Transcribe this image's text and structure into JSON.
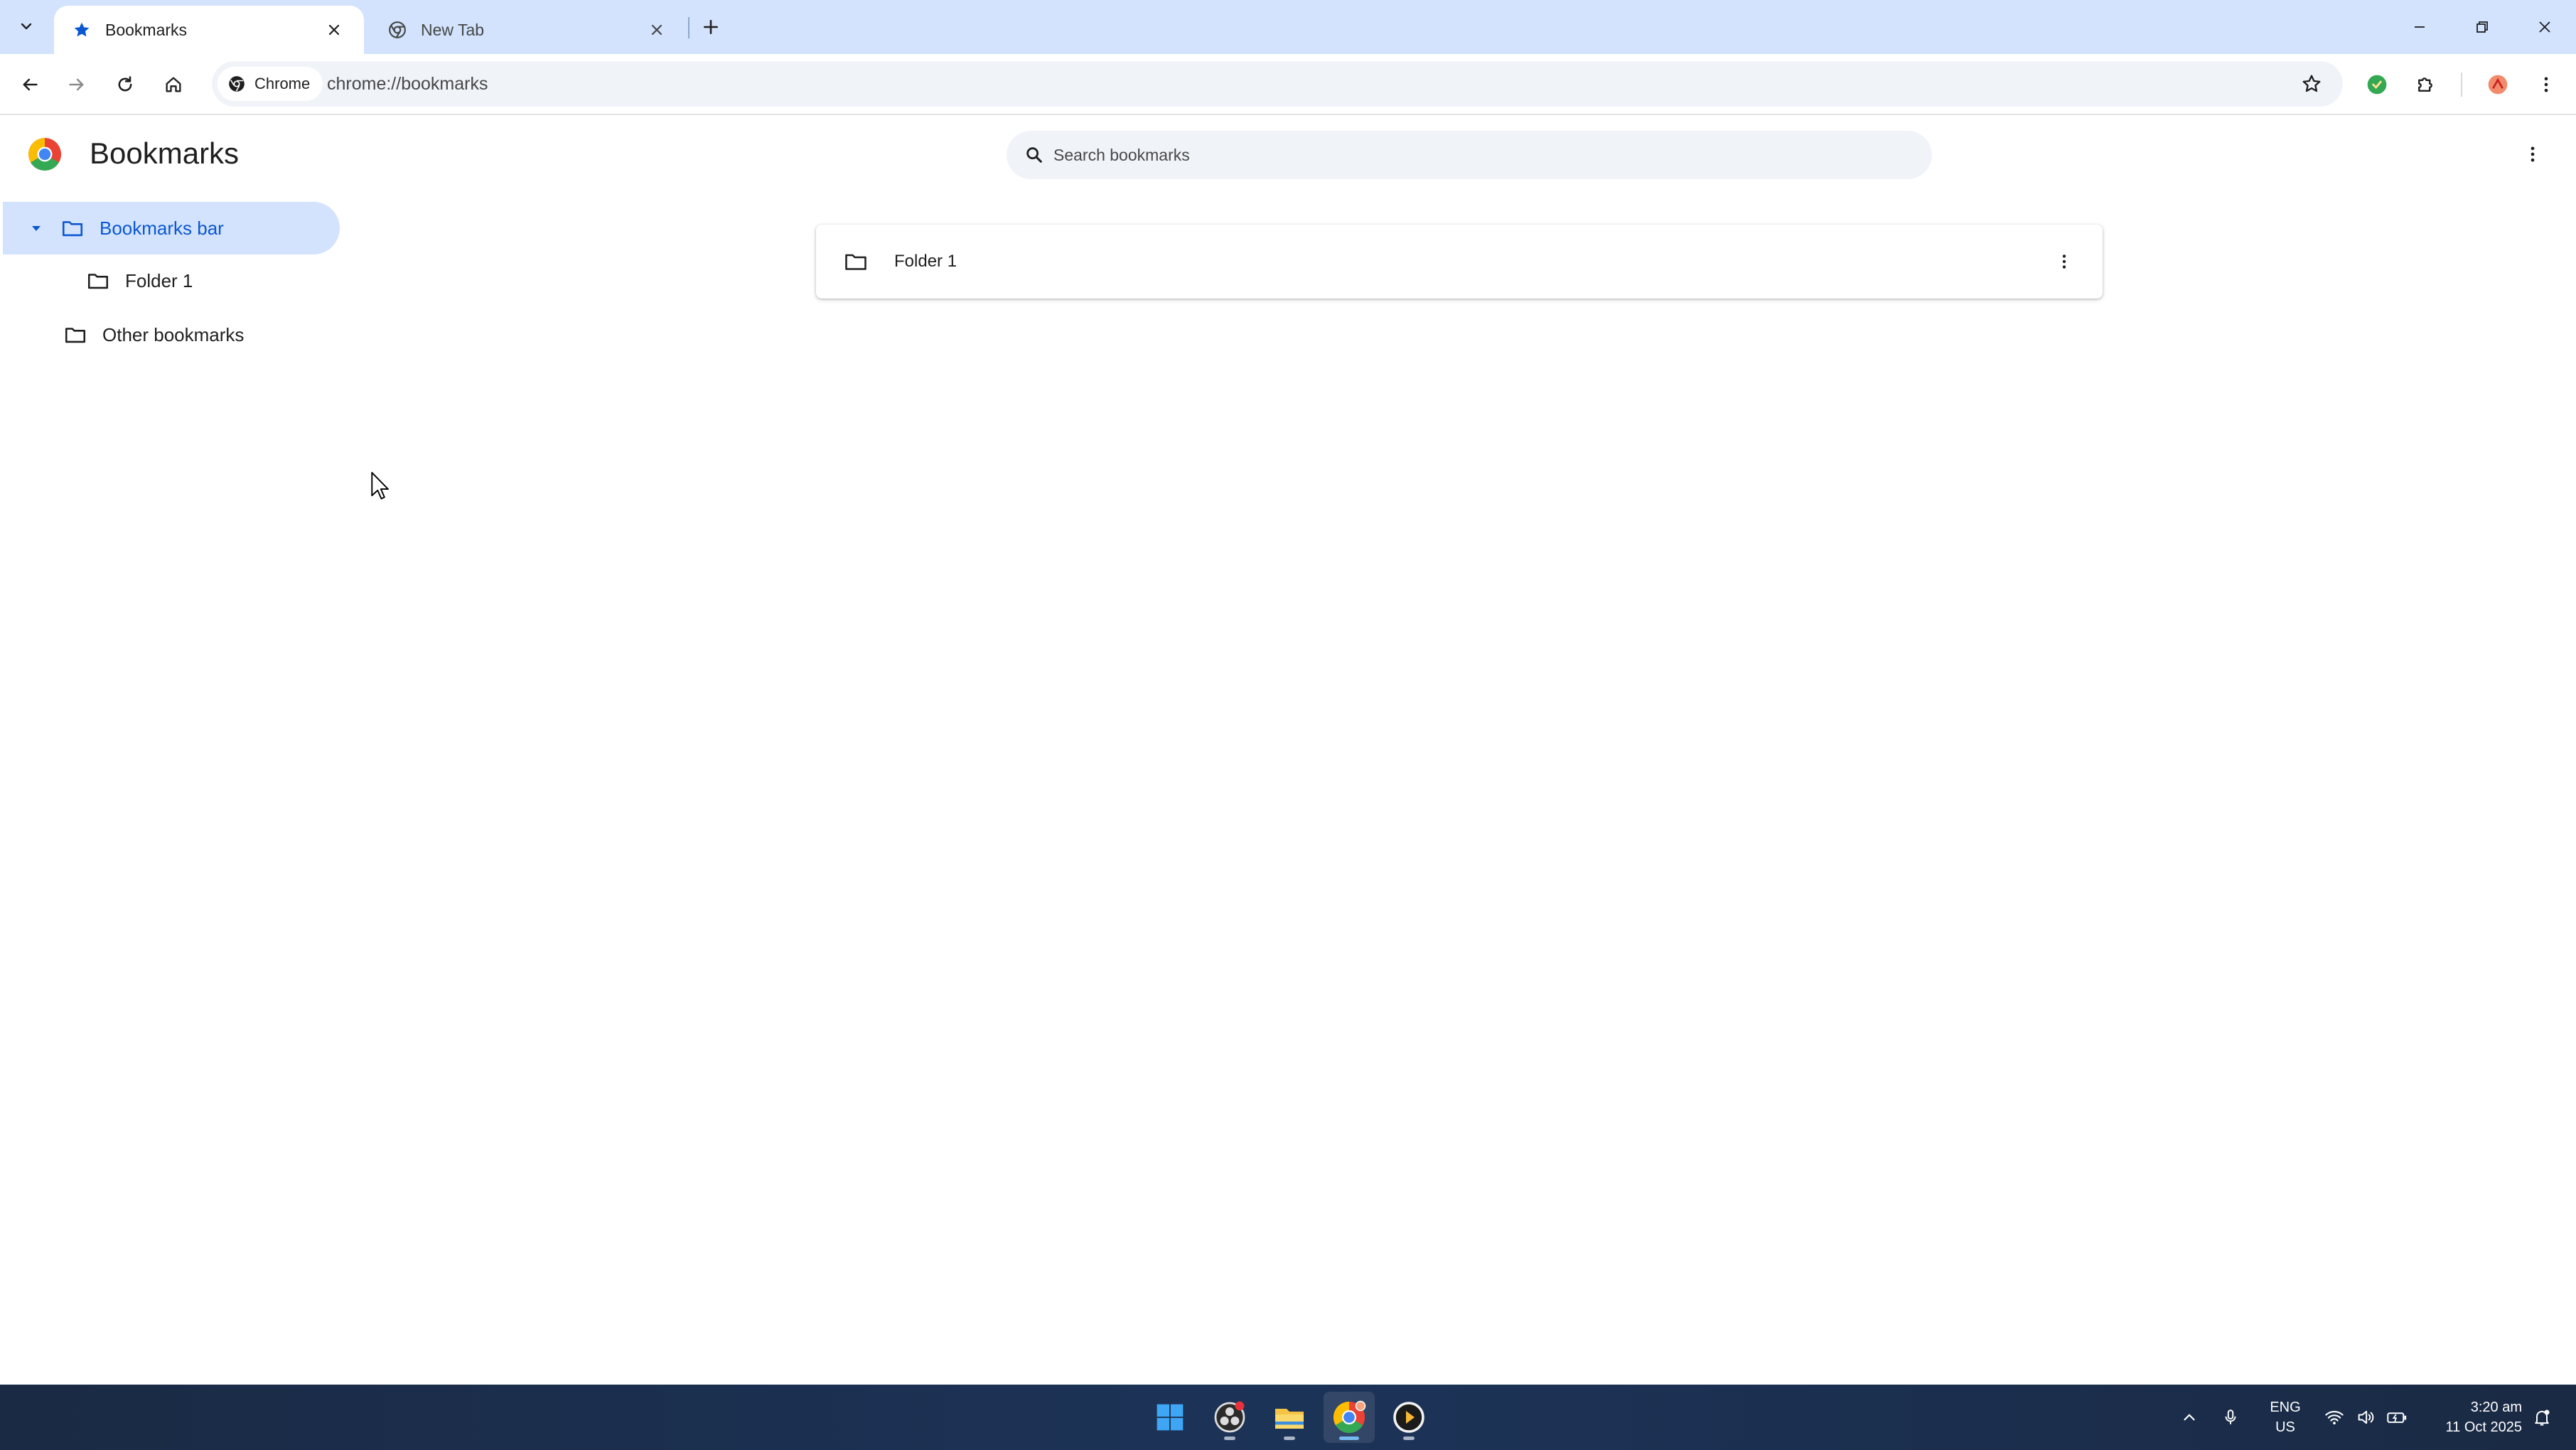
{
  "browser": {
    "tabs": [
      {
        "title": "Bookmarks",
        "active": true,
        "icon": "star-icon"
      },
      {
        "title": "New Tab",
        "active": false,
        "icon": "chrome-icon"
      }
    ],
    "omnibox": {
      "chip_label": "Chrome",
      "url": "chrome://bookmarks"
    }
  },
  "page": {
    "title": "Bookmarks",
    "search": {
      "placeholder": "Search bookmarks",
      "value": ""
    }
  },
  "sidebar": {
    "items": [
      {
        "label": "Bookmarks bar",
        "selected": true,
        "expanded": true
      },
      {
        "label": "Folder 1",
        "selected": false
      },
      {
        "label": "Other bookmarks",
        "selected": false
      }
    ]
  },
  "main": {
    "items": [
      {
        "title": "Folder 1",
        "type": "folder"
      }
    ]
  },
  "taskbar": {
    "apps": [
      "windows-start-icon",
      "obs-icon",
      "file-explorer-icon",
      "chrome-icon",
      "media-player-icon"
    ],
    "language": {
      "line1": "ENG",
      "line2": "US"
    },
    "clock": {
      "time": "3:20 am",
      "date": "11 Oct 2025"
    }
  },
  "colors": {
    "accent": "#0b57d0",
    "tabstrip": "#d3e3fd",
    "selection": "#d3e3fd",
    "field": "#f0f4f9"
  }
}
